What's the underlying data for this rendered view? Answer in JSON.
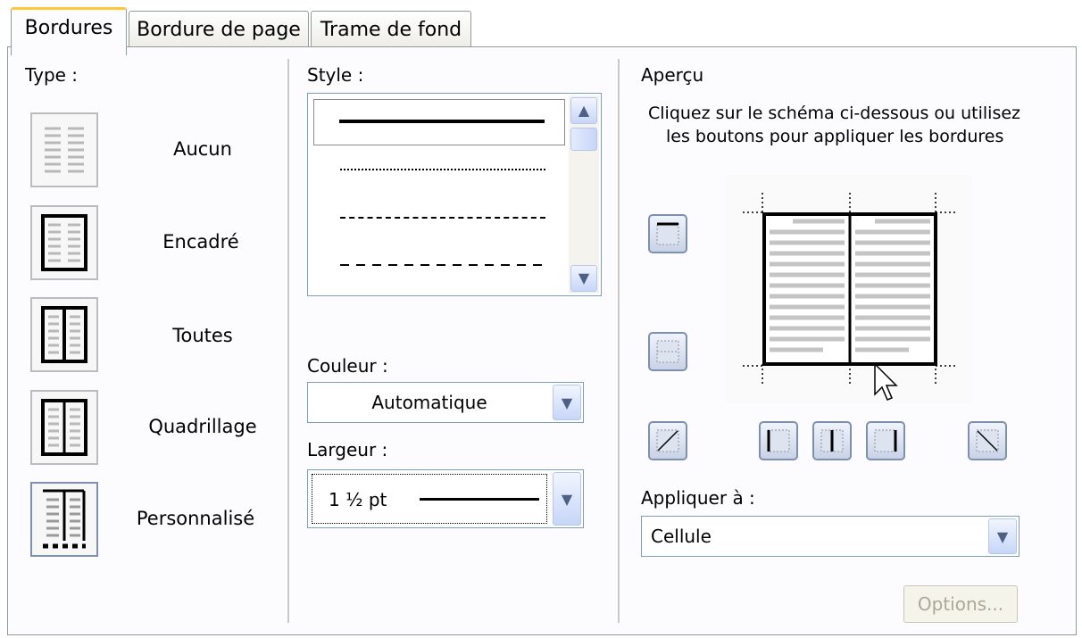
{
  "tabs": [
    {
      "label": "Bordures",
      "active": true
    },
    {
      "label": "Bordure de page",
      "active": false
    },
    {
      "label": "Trame de fond",
      "active": false
    }
  ],
  "type": {
    "heading": "Type :",
    "options": [
      {
        "label": "Aucun",
        "icon": "border-none-icon"
      },
      {
        "label": "Encadré",
        "icon": "border-box-icon"
      },
      {
        "label": "Toutes",
        "icon": "border-all-icon"
      },
      {
        "label": "Quadrillage",
        "icon": "border-grid-icon"
      },
      {
        "label": "Personnalisé",
        "icon": "border-custom-icon",
        "selected": true
      }
    ]
  },
  "style": {
    "heading": "Style :",
    "items": [
      "solid",
      "dotted",
      "dashed-short",
      "dashed-long"
    ],
    "selected": "solid"
  },
  "couleur": {
    "label": "Couleur :",
    "value": "Automatique"
  },
  "largeur": {
    "label": "Largeur :",
    "value": "1 ½ pt"
  },
  "apercu": {
    "heading": "Aperçu",
    "instructions_line1": "Cliquez sur le schéma ci-dessous ou utilisez",
    "instructions_line2": "les boutons pour appliquer les bordures"
  },
  "appliquer": {
    "label": "Appliquer à :",
    "value": "Cellule"
  },
  "options_button": "Options...",
  "colors": {
    "tab_highlight": "#ffc83c",
    "control_border": "#7f9db9",
    "button_border": "#7e90ad"
  }
}
